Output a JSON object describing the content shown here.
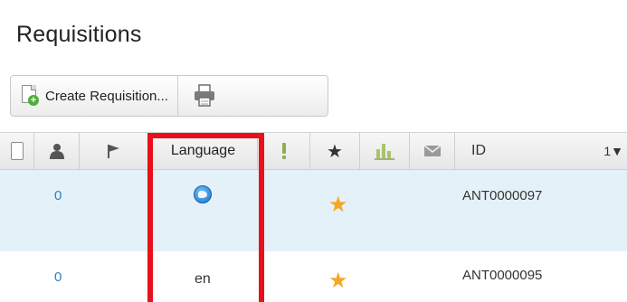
{
  "page": {
    "title": "Requisitions"
  },
  "toolbar": {
    "create_label": "Create Requisition...",
    "create_icon": "document-add-icon",
    "print_icon": "printer-icon"
  },
  "grid": {
    "columns": [
      {
        "key": "select",
        "icon": "checkbox"
      },
      {
        "key": "owner",
        "icon": "person-icon"
      },
      {
        "key": "flag",
        "icon": "flag-icon"
      },
      {
        "key": "language",
        "label": "Language"
      },
      {
        "key": "priority",
        "icon": "exclamation-icon"
      },
      {
        "key": "favorite",
        "icon": "star-icon"
      },
      {
        "key": "stats",
        "icon": "bar-chart-icon"
      },
      {
        "key": "message",
        "icon": "envelope-icon"
      },
      {
        "key": "id",
        "label": "ID",
        "sort_order": "1",
        "sort_direction": "descending"
      }
    ],
    "rows": [
      {
        "count": "0",
        "language_icon": "globe-icon",
        "language": "",
        "favorite": true,
        "id": "ANT0000097"
      },
      {
        "count": "0",
        "language_icon": "",
        "language": "en",
        "favorite": true,
        "id": "ANT0000095"
      }
    ]
  },
  "annotation": {
    "color": "#e8111b",
    "target": "language-column"
  },
  "colors": {
    "link": "#2f7fc4",
    "star": "#f5a623",
    "row_highlight": "#e5f1f9"
  }
}
